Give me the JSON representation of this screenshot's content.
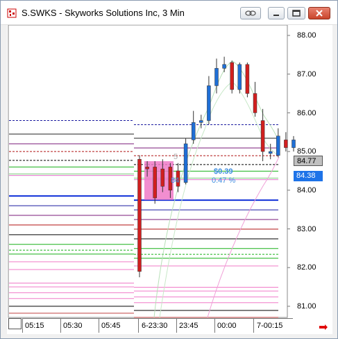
{
  "window": {
    "title": "S.SWKS - Skyworks Solutions Inc, 3 Min",
    "buttons": [
      "link-icon",
      "minimize-icon",
      "maximize-icon",
      "close-icon"
    ]
  },
  "chart": {
    "y_ticks": [
      "88.00",
      "87.00",
      "86.00",
      "85.00",
      "84.00",
      "83.00",
      "82.00",
      "81.00"
    ],
    "x_ticks": [
      "05:15",
      "05:30",
      "05:45",
      "6-23:30",
      "23:45",
      "00:00",
      "7-00:15"
    ],
    "price_tags": [
      {
        "label": "84.77",
        "bg": "#c0c0c0",
        "fg": "#000000"
      },
      {
        "label": "84.38",
        "bg": "#1e73e8",
        "fg": "#ffffff"
      }
    ],
    "annotations": {
      "change": "$0.39",
      "percent": "0.47 %",
      "partial_a": "84",
      "partial_b": "5"
    },
    "colors": {
      "up": "#1f6fd6",
      "down": "#d11f1f",
      "highlight": "#f07ac8"
    }
  },
  "chart_data": {
    "type": "candlestick",
    "ylim": [
      80.7,
      88.6
    ],
    "candles": [
      {
        "o": 84.8,
        "h": 84.9,
        "l": 81.75,
        "c": 81.9
      },
      {
        "o": 84.6,
        "h": 84.75,
        "l": 84.35,
        "c": 84.55
      },
      {
        "o": 84.6,
        "h": 84.75,
        "l": 83.65,
        "c": 83.8
      },
      {
        "o": 84.55,
        "h": 84.8,
        "l": 83.95,
        "c": 84.1
      },
      {
        "o": 84.6,
        "h": 84.7,
        "l": 83.8,
        "c": 84.0
      },
      {
        "o": 84.5,
        "h": 84.7,
        "l": 83.95,
        "c": 84.1
      },
      {
        "o": 84.2,
        "h": 85.35,
        "l": 84.15,
        "c": 85.2
      },
      {
        "o": 85.3,
        "h": 86.05,
        "l": 85.2,
        "c": 85.75
      },
      {
        "o": 85.75,
        "h": 85.95,
        "l": 85.6,
        "c": 85.8
      },
      {
        "o": 85.8,
        "h": 86.95,
        "l": 85.7,
        "c": 86.7
      },
      {
        "o": 86.7,
        "h": 87.4,
        "l": 86.5,
        "c": 87.15
      },
      {
        "o": 87.15,
        "h": 87.45,
        "l": 87.05,
        "c": 87.25
      },
      {
        "o": 87.3,
        "h": 87.35,
        "l": 86.5,
        "c": 86.6
      },
      {
        "o": 86.6,
        "h": 87.3,
        "l": 86.5,
        "c": 87.25
      },
      {
        "o": 87.25,
        "h": 87.3,
        "l": 86.4,
        "c": 86.5
      },
      {
        "o": 86.5,
        "h": 86.8,
        "l": 85.9,
        "c": 86.0
      },
      {
        "o": 85.8,
        "h": 86.1,
        "l": 84.75,
        "c": 85.0
      },
      {
        "o": 84.95,
        "h": 85.2,
        "l": 84.8,
        "c": 85.0
      },
      {
        "o": 84.9,
        "h": 85.6,
        "l": 84.85,
        "c": 85.4
      },
      {
        "o": 85.3,
        "h": 85.5,
        "l": 85.0,
        "c": 85.1
      },
      {
        "o": 85.1,
        "h": 85.4,
        "l": 85.0,
        "c": 85.3
      }
    ],
    "levels": [
      {
        "price": 85.8,
        "color": "#1a1aa0",
        "style": "dashed",
        "scope": "full"
      },
      {
        "price": 85.45,
        "color": "#222222",
        "style": "solid",
        "scope": "full"
      },
      {
        "price": 85.2,
        "color": "#7a1a7a",
        "style": "solid",
        "scope": "full"
      },
      {
        "price": 85.0,
        "color": "#b01010",
        "style": "dashed",
        "scope": "full"
      },
      {
        "price": 84.77,
        "color": "#000000",
        "style": "dashed",
        "scope": "full"
      },
      {
        "price": 84.6,
        "color": "#18b018",
        "style": "solid",
        "scope": "full"
      },
      {
        "price": 84.42,
        "color": "#7acc7a",
        "style": "solid",
        "scope": "full"
      },
      {
        "price": 84.38,
        "color": "#e070c8",
        "style": "solid",
        "scope": "full"
      },
      {
        "price": 83.85,
        "color": "#1030d8",
        "style": "solid",
        "scope": "full"
      },
      {
        "price": 83.6,
        "color": "#1a1aa0",
        "style": "solid",
        "scope": "full"
      },
      {
        "price": 83.35,
        "color": "#7a1a7a",
        "style": "solid",
        "scope": "full"
      },
      {
        "price": 83.1,
        "color": "#b01010",
        "style": "solid",
        "scope": "full"
      },
      {
        "price": 82.85,
        "color": "#000000",
        "style": "solid",
        "scope": "full"
      },
      {
        "price": 82.6,
        "color": "#18b018",
        "style": "solid",
        "scope": "full"
      },
      {
        "price": 82.45,
        "color": "#18b018",
        "style": "dashed",
        "scope": "full"
      },
      {
        "price": 82.35,
        "color": "#18b018",
        "style": "solid",
        "scope": "full"
      },
      {
        "price": 82.15,
        "color": "#f07ac8",
        "style": "solid",
        "scope": "full"
      },
      {
        "price": 81.95,
        "color": "#f07ac8",
        "style": "solid",
        "scope": "left"
      },
      {
        "price": 81.6,
        "color": "#f07ac8",
        "style": "solid",
        "scope": "full"
      },
      {
        "price": 81.5,
        "color": "#f07ac8",
        "style": "solid",
        "scope": "full"
      },
      {
        "price": 81.35,
        "color": "#f07ac8",
        "style": "solid",
        "scope": "full"
      },
      {
        "price": 81.2,
        "color": "#f07ac8",
        "style": "solid",
        "scope": "full"
      },
      {
        "price": 81.0,
        "color": "#000000",
        "style": "solid",
        "scope": "full"
      },
      {
        "price": 80.82,
        "color": "#c04040",
        "style": "solid",
        "scope": "full"
      }
    ]
  }
}
